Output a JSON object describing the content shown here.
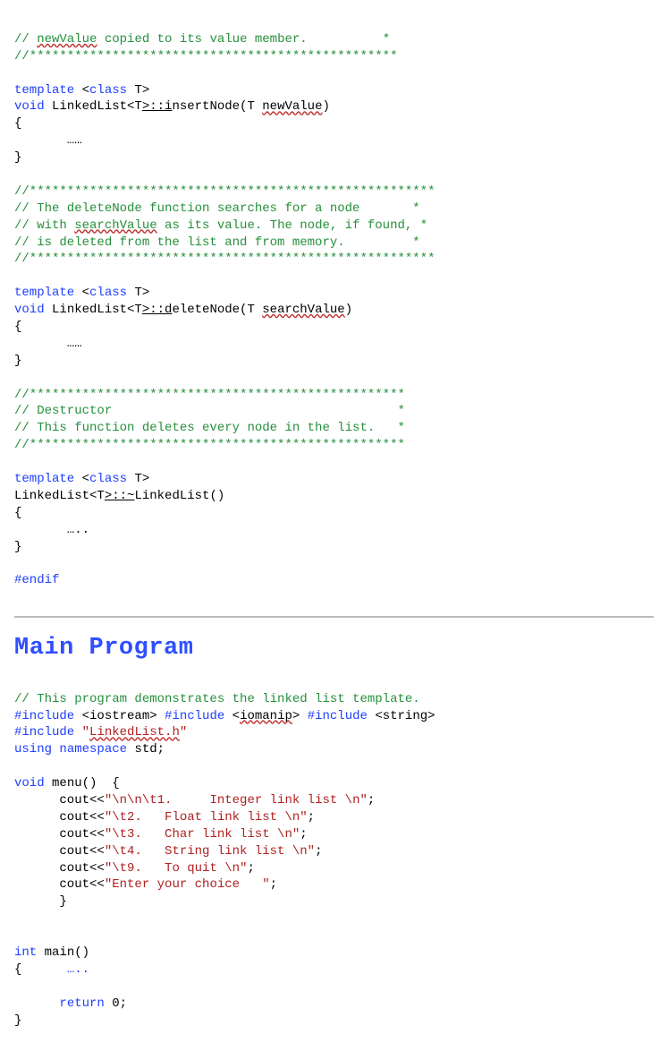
{
  "block1": {
    "c1": "// ",
    "c1b": "newValue",
    "c1c": " copied to its value member.          *",
    "c2": "//*************************************************",
    "t1a": "template ",
    "t1b": "<",
    "t1c": "class",
    "t1d": " T>",
    "fn1a": "void",
    "fn1b": " LinkedList<T",
    "fn1c": ">::i",
    "fn1d": "nsertNode(T ",
    "fn1e": "newValue",
    "fn1f": ")",
    "brace_open": "{",
    "ellipsis1": "       ……",
    "brace_close": "}"
  },
  "block2": {
    "c1": "//******************************************************",
    "c2": "// The deleteNode function searches for a node       *",
    "c3a": "// with ",
    "c3b": "searchValue",
    "c3c": " as its value. The node, if found, *",
    "c4": "// is deleted from the list and from memory.         *",
    "c5": "//******************************************************",
    "t1a": "template ",
    "t1b": "<",
    "t1c": "class",
    "t1d": " T>",
    "fn1a": "void",
    "fn1b": " LinkedList<T",
    "fn1c": ">::d",
    "fn1d": "eleteNode(T ",
    "fn1e": "searchValue",
    "fn1f": ")",
    "brace_open": "{",
    "ellipsis": "       ……",
    "brace_close": "}"
  },
  "block3": {
    "c1": "//**************************************************",
    "c2": "// Destructor                                      *",
    "c3": "// This function deletes every node in the list.   *",
    "c4": "//**************************************************",
    "t1a": "template ",
    "t1b": "<",
    "t1c": "class",
    "t1d": " T>",
    "fn1a": "LinkedList<T",
    "fn1b": ">::~",
    "fn1c": "LinkedList()",
    "brace_open": "{",
    "ellipsis": "       …..",
    "brace_close": "}"
  },
  "endif": "#endif",
  "heading": "Main Program",
  "main": {
    "c1": "// This program demonstrates the linked list template.",
    "inc1a": "#include",
    "inc1b": " <iostream> ",
    "inc1c": "#include",
    "inc1d": " <",
    "inc1e": "iomanip",
    "inc1f": "> ",
    "inc1g": "#include",
    "inc1h": " <string>",
    "inc2a": "#include",
    "inc2b": " \"",
    "inc2c": "LinkedList.h",
    "inc2d": "\"",
    "using_a": "using",
    "using_b": " ",
    "using_c": "namespace",
    "using_d": " std;",
    "menu_a": "void",
    "menu_b": " menu()  {",
    "m1a": "      cout<<",
    "m1b": "\"\\n\\n\\t1.     Integer link list \\n\"",
    "m1c": ";",
    "m2a": "      cout<<",
    "m2b": "\"\\t2.   Float link list \\n\"",
    "m2c": ";",
    "m3a": "      cout<<",
    "m3b": "\"\\t3.   Char link list \\n\"",
    "m3c": ";",
    "m4a": "      cout<<",
    "m4b": "\"\\t4.   String link list \\n\"",
    "m4c": ";",
    "m5a": "      cout<<",
    "m5b": "\"\\t9.   To quit \\n\"",
    "m5c": ";",
    "m6a": "      cout<<",
    "m6b": "\"Enter your choice   \"",
    "m6c": ";",
    "m_close": "      }",
    "main_a": "int",
    "main_b": " main()",
    "main_open": "{      ",
    "main_open_ell": "…..",
    "ret_a": "      ",
    "ret_b": "return",
    "ret_c": " 0;",
    "main_close": "}"
  }
}
